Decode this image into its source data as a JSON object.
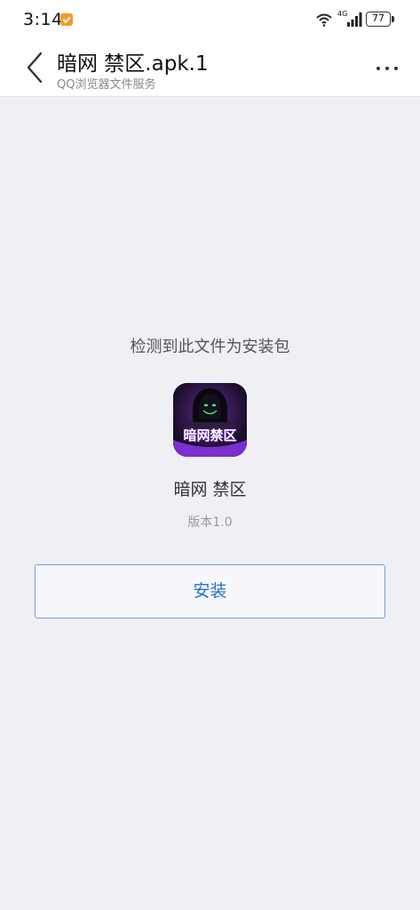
{
  "status_bar": {
    "time": "3:14",
    "network": "4G",
    "battery": "77"
  },
  "header": {
    "title": "暗网 禁区.apk.1",
    "subtitle": "QQ浏览器文件服务"
  },
  "main": {
    "detect_message": "检测到此文件为安装包",
    "app_icon_text": "暗网禁区",
    "app_name": "暗网 禁区",
    "version": "版本1.0",
    "install_label": "安装"
  },
  "colors": {
    "background": "#eff0f4",
    "accent": "#2a6fc9",
    "button_border": "#6ea2db",
    "icon_bg": "#1a1226",
    "icon_accent": "#7b2fd1"
  },
  "icons": [
    "notification-icon",
    "wifi-icon",
    "signal-icon",
    "battery-icon",
    "back-icon",
    "more-icon",
    "app-icon"
  ]
}
